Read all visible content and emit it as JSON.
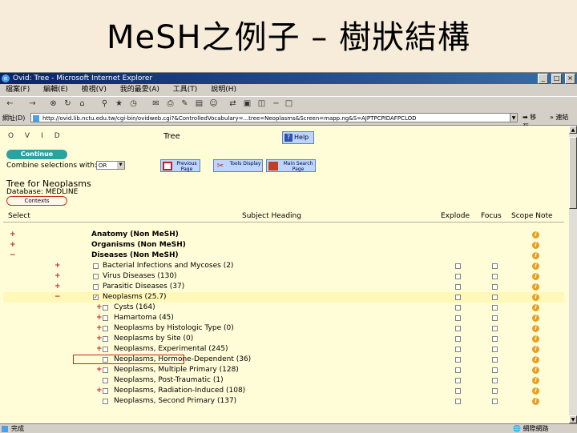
{
  "slide": {
    "title": "MeSH之例子 – 樹狀結構"
  },
  "browser": {
    "title": "Ovid: Tree - Microsoft Internet Explorer",
    "menu": [
      "檔案(F)",
      "編輯(E)",
      "檢視(V)",
      "我的最愛(A)",
      "工具(T)",
      "說明(H)"
    ],
    "address_label": "網址(D)",
    "url": "http://ovid.lib.nctu.edu.tw/cgi-bin/ovidweb.cgi?&ControlledVocabulary=...tree=Neoplasms&Screen=mapp.ng&S=AJPTPCPIDAFPCLOD",
    "go_label": "移至",
    "links_label": "連結",
    "status_text": "完成",
    "status_zone": "網際網路",
    "window_buttons": [
      "_",
      "□",
      "×"
    ]
  },
  "page": {
    "logo": "OVID",
    "heading": "Tree",
    "help_label": "Help",
    "continue_label": "Continue",
    "combine_label": "Combine selections with:",
    "combine_value": "OR",
    "nav_buttons": [
      {
        "label": "Previous Page"
      },
      {
        "label": "Tools Display"
      },
      {
        "label": "Main Search Page"
      }
    ],
    "tree_heading": "Tree for Neoplasms",
    "database": "Database: MEDLINE",
    "contexts_label": "Contexts"
  },
  "table": {
    "headers": {
      "select": "Select",
      "subject": "Subject Heading",
      "explode": "Explode",
      "focus": "Focus",
      "scope": "Scope Note"
    },
    "rows": [
      {
        "sel1": "+",
        "sel2": "",
        "cb": false,
        "label": "Anatomy (Non MeSH)",
        "nonmesh": true,
        "hl": false
      },
      {
        "sel1": "+",
        "sel2": "",
        "cb": false,
        "label": "Organisms (Non MeSH)",
        "nonmesh": true,
        "hl": false
      },
      {
        "sel1": "−",
        "sel2": "",
        "cb": false,
        "label": "Diseases (Non MeSH)",
        "nonmesh": true,
        "hl": false
      },
      {
        "sel1": "",
        "sel2": "+",
        "cb": true,
        "label": "Bacterial Infections and Mycoses (2)",
        "nonmesh": false,
        "hl": false
      },
      {
        "sel1": "",
        "sel2": "+",
        "cb": true,
        "label": "Virus Diseases (130)",
        "nonmesh": false,
        "hl": false
      },
      {
        "sel1": "",
        "sel2": "+",
        "cb": true,
        "label": "Parasitic Diseases (37)",
        "nonmesh": false,
        "hl": false
      },
      {
        "sel1": "",
        "sel2": "−",
        "cb": true,
        "checked": true,
        "label": "Neoplasms (25.7)",
        "nonmesh": false,
        "hl": true
      },
      {
        "sel1": "",
        "sel3": "+",
        "cb2": true,
        "label": "Cysts (164)",
        "nonmesh": false,
        "hl": false
      },
      {
        "sel1": "",
        "sel3": "+",
        "cb2": true,
        "label": "Hamartoma (45)",
        "nonmesh": false,
        "hl": false
      },
      {
        "sel1": "",
        "sel3": "+",
        "cb2": true,
        "label": "Neoplasms by Histologic Type (0)",
        "nonmesh": false,
        "hl": false
      },
      {
        "sel1": "",
        "sel3": "+",
        "cb2": true,
        "label": "Neoplasms by Site (0)",
        "nonmesh": false,
        "hl": false
      },
      {
        "sel1": "",
        "sel3": "+",
        "cb2": true,
        "label": "Neoplasms, Experimental (245)",
        "nonmesh": false,
        "hl": false
      },
      {
        "sel1": "",
        "sel3": "",
        "cb2": true,
        "label": "Neoplasms, Hormone-Dependent (36)",
        "nonmesh": false,
        "hl": false
      },
      {
        "sel1": "",
        "sel3": "+",
        "cb2": true,
        "label": "Neoplasms, Multiple Primary (128)",
        "nonmesh": false,
        "hl": false
      },
      {
        "sel1": "",
        "sel3": "",
        "cb2": true,
        "label": "Neoplasms, Post-Traumatic (1)",
        "nonmesh": false,
        "hl": false
      },
      {
        "sel1": "",
        "sel3": "+",
        "cb2": true,
        "label": "Neoplasms, Radiation-Induced (108)",
        "nonmesh": false,
        "hl": false
      },
      {
        "sel1": "",
        "sel3": "",
        "cb2": true,
        "label": "Neoplasms, Second Primary (137)",
        "nonmesh": false,
        "hl": false
      }
    ]
  },
  "colors": {
    "page_bg": "#fffdd8",
    "slide_bg": "#f6ecd9",
    "highlight_box": "#d02010",
    "continue": "#2ba2a0",
    "info": "#e6a020"
  }
}
